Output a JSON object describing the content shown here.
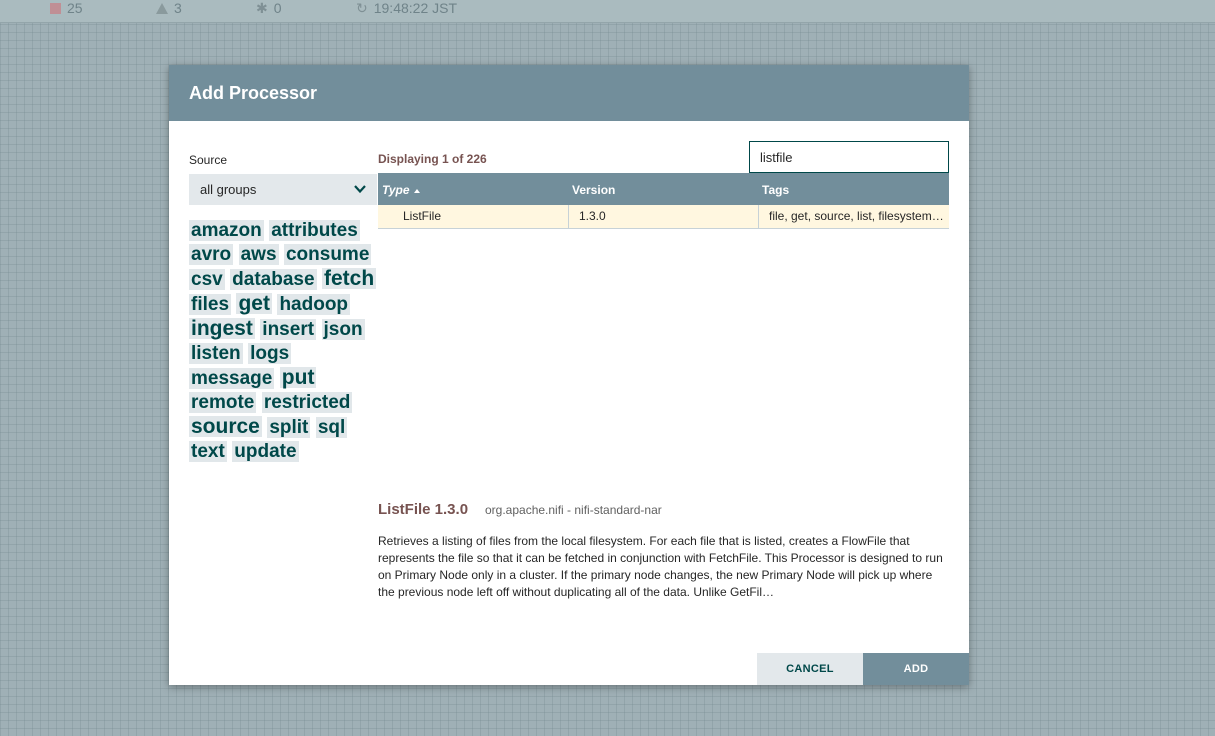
{
  "statusbar": {
    "stopped_count": "25",
    "invalid_count": "3",
    "disabled_count": "0",
    "last_refreshed": "19:48:22 JST"
  },
  "dialog": {
    "title": "Add Processor",
    "source_label": "Source",
    "source_value": "all groups",
    "tags": [
      {
        "label": "amazon",
        "weight": 2
      },
      {
        "label": "attributes",
        "weight": 2
      },
      {
        "label": "avro",
        "weight": 2
      },
      {
        "label": "aws",
        "weight": 2
      },
      {
        "label": "consume",
        "weight": 2
      },
      {
        "label": "csv",
        "weight": 2
      },
      {
        "label": "database",
        "weight": 2
      },
      {
        "label": "fetch",
        "weight": 3
      },
      {
        "label": "files",
        "weight": 2
      },
      {
        "label": "get",
        "weight": 3
      },
      {
        "label": "hadoop",
        "weight": 2
      },
      {
        "label": "ingest",
        "weight": 3
      },
      {
        "label": "insert",
        "weight": 2
      },
      {
        "label": "json",
        "weight": 2
      },
      {
        "label": "listen",
        "weight": 2
      },
      {
        "label": "logs",
        "weight": 2
      },
      {
        "label": "message",
        "weight": 2
      },
      {
        "label": "put",
        "weight": 3
      },
      {
        "label": "remote",
        "weight": 2
      },
      {
        "label": "restricted",
        "weight": 2
      },
      {
        "label": "source",
        "weight": 3
      },
      {
        "label": "split",
        "weight": 2
      },
      {
        "label": "sql",
        "weight": 2
      },
      {
        "label": "text",
        "weight": 2
      },
      {
        "label": "update",
        "weight": 2
      }
    ],
    "displaying": "Displaying 1 of 226",
    "filter_value": "listfile",
    "table": {
      "headers": {
        "type": "Type",
        "version": "Version",
        "tags": "Tags"
      },
      "rows": [
        {
          "type": "ListFile",
          "version": "1.3.0",
          "tags": "file, get, source, list, filesystem, ingest, ingress"
        }
      ]
    },
    "details": {
      "title": "ListFile 1.3.0",
      "bundle": "org.apache.nifi - nifi-standard-nar",
      "description": "Retrieves a listing of files from the local filesystem. For each file that is listed, creates a FlowFile that represents the file so that it can be fetched in conjunction with FetchFile. This Processor is designed to run on Primary Node only in a cluster. If the primary node changes, the new Primary Node will pick up where the previous node left off without duplicating all of the data. Unlike GetFil…"
    },
    "buttons": {
      "cancel": "CANCEL",
      "add": "ADD"
    }
  }
}
